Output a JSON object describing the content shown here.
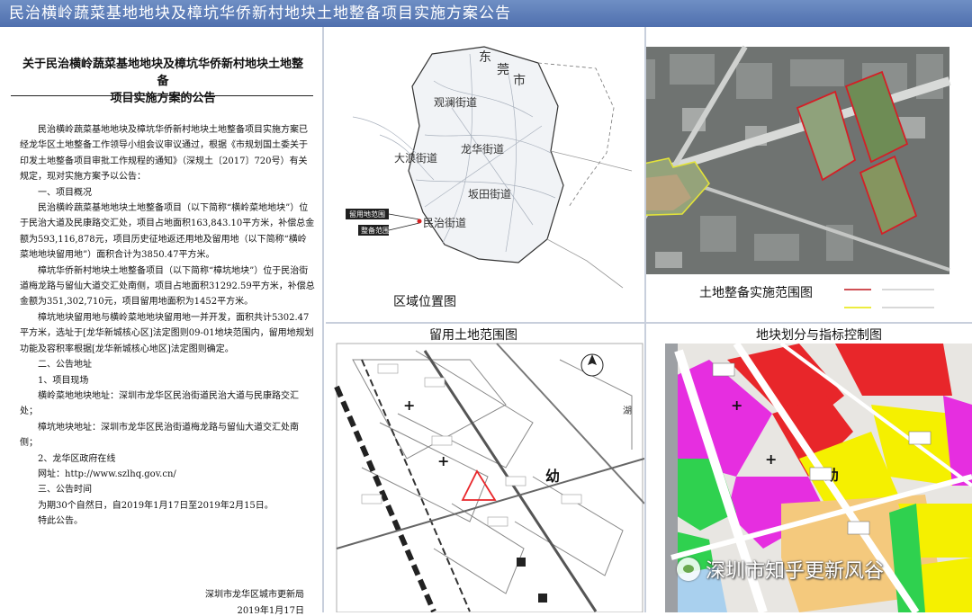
{
  "banner": {
    "title": "民治横岭蔬菜基地地块及樟坑华侨新村地块土地整备项目实施方案公告"
  },
  "notice": {
    "title_line1": "关于民治横岭蔬菜基地地块及樟坑华侨新村地块土地整备",
    "title_line2": "项目实施方案的公告",
    "paragraphs": [
      {
        "text": "民治横岭蔬菜基地地块及樟坑华侨新村地块土地整备项目实施方案已经龙华区土地整备工作领导小组会议审议通过，根据《市规划国土委关于印发土地整备项目审批工作规程的通知》（深规土〔2017〕720号）有关规定，现对实施方案予以公告：",
        "indent": true
      },
      {
        "text": "一、项目概况",
        "indent": true
      },
      {
        "text": "民治横岭蔬菜基地地块土地整备项目（以下简称“横岭菜地地块”）位于民治大道及民康路交汇处，项目占地面积163,843.10平方米，补偿总金额为593,116,878元，项目历史征地返还用地及留用地（以下简称“横岭菜地地块留用地”）面积合计为3850.47平方米。",
        "indent": true
      },
      {
        "text": "樟坑华侨新村地块土地整备项目（以下简称“樟坑地块”）位于民治街道梅龙路与留仙大道交汇处南侧，项目占地面积31292.59平方米，补偿总金额为351,302,710元，项目留用地面积为1452平方米。",
        "indent": true
      },
      {
        "text": "樟坑地块留用地与横岭菜地地块留用地一并开发，面积共计5302.47平方米，选址于[龙华新城核心区]法定图则09-01地块范围内，留用地规划功能及容积率根据[龙华新城核心地区]法定图则确定。",
        "indent": true
      },
      {
        "text": "二、公告地址",
        "indent": true
      },
      {
        "text": "1、项目现场",
        "indent": true
      },
      {
        "text": "横岭菜地地块地址：深圳市龙华区民治街道民治大道与民康路交汇处；",
        "indent": true
      },
      {
        "text": "樟坑地块地址：深圳市龙华区民治街道梅龙路与留仙大道交汇处南侧；",
        "indent": true
      },
      {
        "text": "2、龙华区政府在线",
        "indent": true
      },
      {
        "text": "网址：http://www.szlhq.gov.cn/",
        "indent": true
      },
      {
        "text": "三、公告时间",
        "indent": true
      },
      {
        "text": "为期30个自然日，自2019年1月17日至2019年2月15日。",
        "indent": true
      },
      {
        "text": "特此公告。",
        "indent": true
      }
    ],
    "signature_org": "深圳市龙华区城市更新局",
    "signature_date": "2019年1月17日"
  },
  "maps": {
    "location": {
      "caption": "区域位置图",
      "labels": [
        "东",
        "莞",
        "市",
        "观澜街道",
        "大浪街道",
        "龙华街道",
        "坂田街道",
        "民治街道"
      ],
      "legend": [
        "留用地范围",
        "整备范围"
      ]
    },
    "scope": {
      "caption": "土地整备实施范围图"
    },
    "retained": {
      "caption": "留用土地范围图",
      "labels": [
        "幼"
      ]
    },
    "zoning": {
      "caption": "地块划分与指标控制图",
      "labels": [
        "幼"
      ]
    }
  },
  "watermark": {
    "text": "深圳市知乎更新风谷"
  },
  "colors": {
    "banner": "#5b7bb7",
    "plot_red": "#e8262a",
    "plot_magenta": "#e62ee0",
    "plot_yellow": "#f5f000",
    "plot_orange": "#f4c97d",
    "plot_green": "#2fd14f",
    "scope_outline": "#c0161d",
    "retained_outline": "#e5e600"
  }
}
